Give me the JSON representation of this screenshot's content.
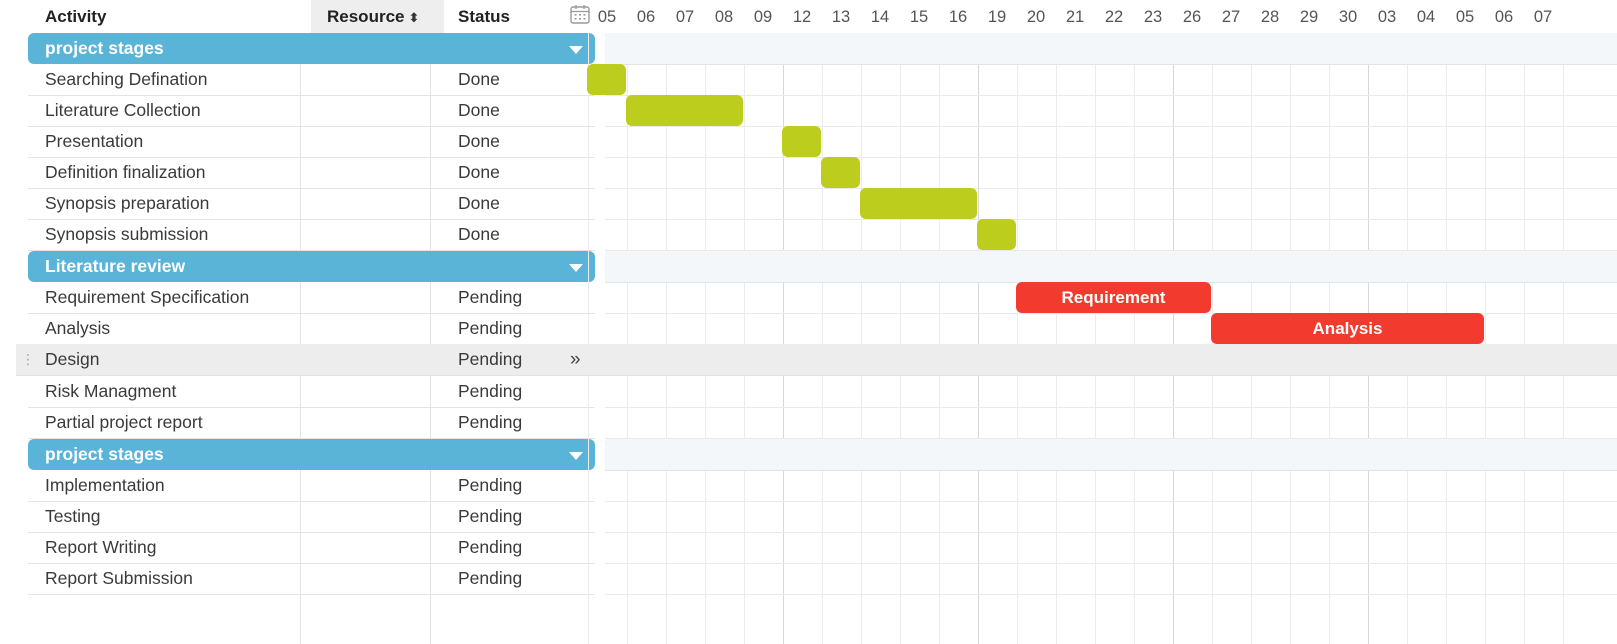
{
  "header": {
    "activity_label": "Activity",
    "resource_label": "Resource",
    "resource_sort_icon": "⬍",
    "status_label": "Status"
  },
  "timeline": {
    "days": [
      "05",
      "06",
      "07",
      "08",
      "09",
      "12",
      "13",
      "14",
      "15",
      "16",
      "19",
      "20",
      "21",
      "22",
      "23",
      "26",
      "27",
      "28",
      "29",
      "30",
      "03",
      "04",
      "05",
      "06",
      "07"
    ]
  },
  "groups": [
    {
      "label": "project stages"
    },
    {
      "label": "Literature review"
    },
    {
      "label": "project stages"
    }
  ],
  "tasks": [
    {
      "activity": "Searching Defination",
      "status": "Done"
    },
    {
      "activity": "Literature Collection",
      "status": "Done"
    },
    {
      "activity": "Presentation",
      "status": "Done"
    },
    {
      "activity": "Definition finalization",
      "status": "Done"
    },
    {
      "activity": "Synopsis preparation",
      "status": "Done"
    },
    {
      "activity": "Synopsis submission",
      "status": "Done"
    },
    {
      "activity": "Requirement Specification",
      "status": "Pending"
    },
    {
      "activity": "Analysis",
      "status": "Pending"
    },
    {
      "activity": "Design",
      "status": "Pending"
    },
    {
      "activity": "Risk Managment",
      "status": "Pending"
    },
    {
      "activity": "Partial project report",
      "status": "Pending"
    },
    {
      "activity": "Implementation",
      "status": "Pending"
    },
    {
      "activity": "Testing",
      "status": "Pending"
    },
    {
      "activity": "Report Writing",
      "status": "Pending"
    },
    {
      "activity": "Report Submission",
      "status": "Pending"
    }
  ],
  "selected_row": {
    "expand_icon": "»",
    "drag_handle_icon": "⋮"
  },
  "bars": [
    {
      "task": "Searching Defination",
      "start": "05",
      "end": "05",
      "label": ""
    },
    {
      "task": "Literature Collection",
      "start": "06",
      "end": "08",
      "label": ""
    },
    {
      "task": "Presentation",
      "start": "12",
      "end": "12",
      "label": ""
    },
    {
      "task": "Definition finalization",
      "start": "13",
      "end": "13",
      "label": ""
    },
    {
      "task": "Synopsis preparation",
      "start": "14",
      "end": "16",
      "label": ""
    },
    {
      "task": "Synopsis submission",
      "start": "19",
      "end": "19",
      "label": ""
    },
    {
      "task": "Requirement Specification",
      "start": "20",
      "end": "26",
      "label": "Requirement"
    },
    {
      "task": "Analysis",
      "start": "27",
      "end": "05",
      "label": "Analysis"
    }
  ],
  "colors": {
    "group_header": "#5ab4d8",
    "bar_done": "#bccd1e",
    "bar_pending": "#f23b2e",
    "selected_row": "#ededed"
  }
}
